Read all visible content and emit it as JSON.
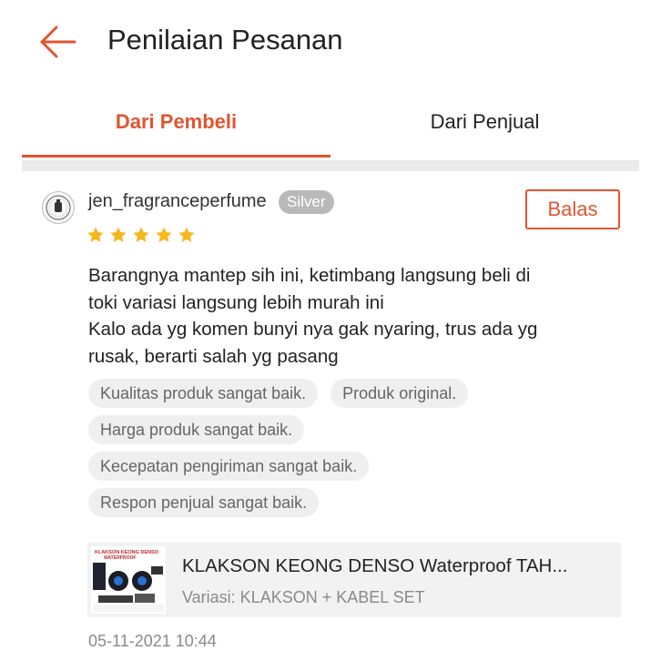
{
  "header": {
    "title": "Penilaian Pesanan",
    "back_icon": "arrow-left-icon"
  },
  "tabs": [
    {
      "label": "Dari Pembeli",
      "active": true
    },
    {
      "label": "Dari Penjual",
      "active": false
    }
  ],
  "colors": {
    "accent": "#e0552f",
    "star": "#f5b81c",
    "badge": "#b9b9b9",
    "tag_bg": "#efefef"
  },
  "review": {
    "username": "jen_fragranceperfume",
    "tier": "Silver",
    "reply_label": "Balas",
    "rating": 5,
    "rating_max": 5,
    "text_lines": [
      "Barangnya mantep sih ini, ketimbang langsung beli di",
      "toki variasi langsung lebih murah ini",
      "Kalo ada yg komen bunyi nya gak nyaring, trus ada yg",
      "rusak, berarti salah yg pasang"
    ],
    "tags": [
      "Kualitas produk sangat baik.",
      "Produk original.",
      "Harga produk sangat baik.",
      "Kecepatan pengiriman sangat baik.",
      "Respon penjual sangat baik."
    ],
    "product": {
      "name": "KLAKSON KEONG DENSO Waterproof TAH...",
      "variant": "Variasi: KLAKSON + KABEL SET",
      "thumb_text": "KLAKSON KEONG DENSO WATERPROOF"
    },
    "date": "05-11-2021 10:44"
  }
}
